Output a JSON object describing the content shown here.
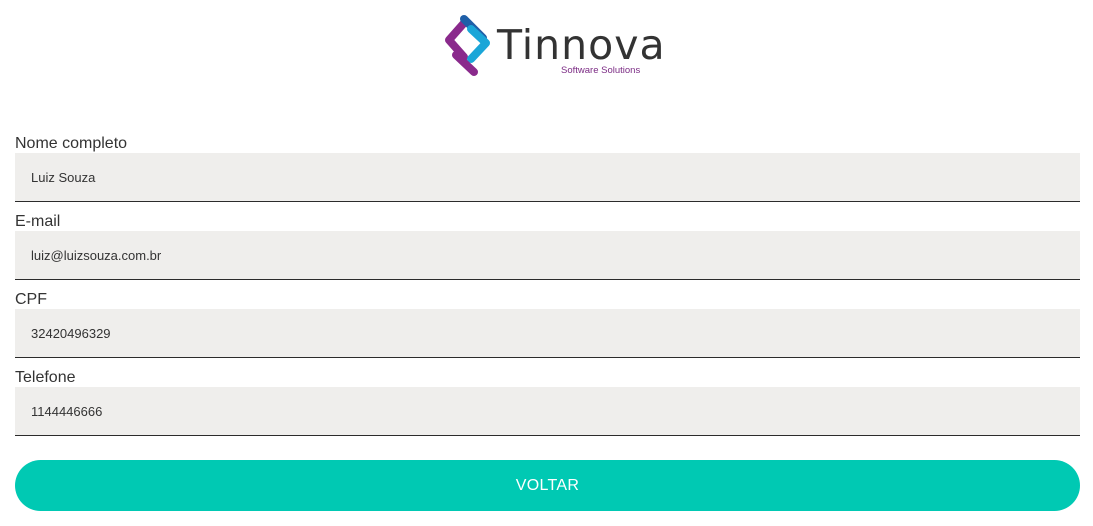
{
  "brand": {
    "name": "Tinnova",
    "tagline": "Software Solutions",
    "colors": {
      "purple": "#8a2a8c",
      "blue": "#1f5fa8",
      "cyan": "#1aa6d8",
      "accent": "#00c9b3"
    }
  },
  "form": {
    "fields": [
      {
        "label": "Nome completo",
        "value": "Luiz Souza"
      },
      {
        "label": "E-mail",
        "value": "luiz@luizsouza.com.br"
      },
      {
        "label": "CPF",
        "value": "32420496329"
      },
      {
        "label": "Telefone",
        "value": "1144446666"
      }
    ]
  },
  "actions": {
    "back_label": "VOLTAR"
  }
}
